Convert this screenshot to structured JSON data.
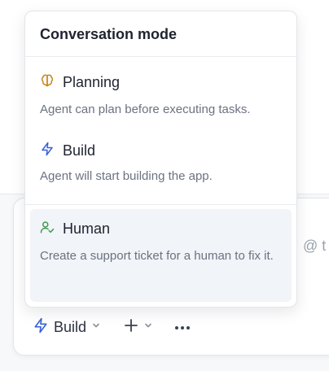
{
  "dropdown": {
    "title": "Conversation mode",
    "options": [
      {
        "label": "Planning",
        "description": "Agent can plan before executing tasks.",
        "icon": "brain-icon",
        "icon_color": "#c8861d"
      },
      {
        "label": "Build",
        "description": "Agent will start building the app.",
        "icon": "lightning-icon",
        "icon_color": "#3b63d6"
      },
      {
        "label": "Human",
        "description": "Create a support ticket for a human to fix it.",
        "icon": "user-check-icon",
        "icon_color": "#3f9a4f",
        "selected": true
      }
    ]
  },
  "composer": {
    "hint": "@ t"
  },
  "toolbar": {
    "mode_label": "Build",
    "mode_icon": "lightning-icon",
    "add_icon": "plus-icon",
    "more_icon": "more-horizontal-icon"
  },
  "colors": {
    "accent": "#3b63d6",
    "selected_bg": "#f1f4f8",
    "human_icon": "#3f9a4f",
    "planning_icon": "#c8861d"
  }
}
